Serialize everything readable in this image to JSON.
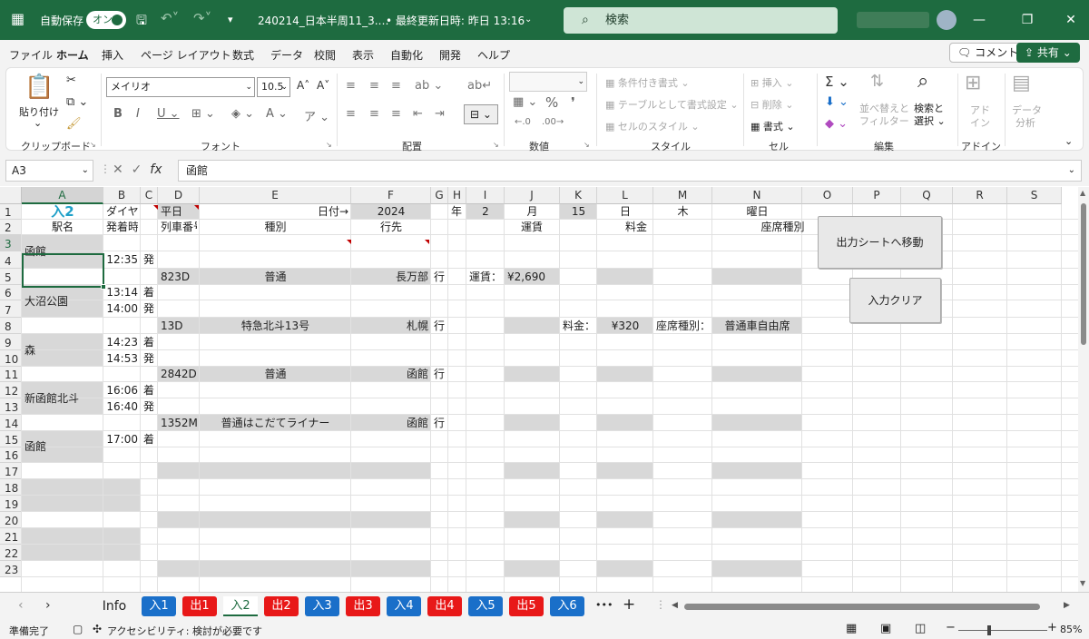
{
  "titlebar": {
    "autosave_label": "自動保存",
    "autosave_state": "オン",
    "filename": "240214_日本半周11_3.…",
    "last_modified": "• 最終更新日時: 昨日 13:16",
    "search_placeholder": "検索"
  },
  "menu": {
    "items": [
      "ファイル",
      "ホーム",
      "挿入",
      "ページ レイアウト",
      "数式",
      "データ",
      "校閲",
      "表示",
      "自動化",
      "開発",
      "ヘルプ"
    ],
    "comment_label": "コメント",
    "share_label": "共有"
  },
  "ribbon": {
    "clipboard": {
      "paste": "貼り付け",
      "group": "クリップボード"
    },
    "font": {
      "name": "メイリオ",
      "size": "10.5",
      "group": "フォント"
    },
    "alignment": {
      "group": "配置"
    },
    "number": {
      "group": "数値"
    },
    "styles": {
      "conditional": "条件付き書式",
      "table": "テーブルとして書式設定",
      "cell_style": "セルのスタイル",
      "group": "スタイル"
    },
    "cells": {
      "insert": "挿入",
      "delete": "削除",
      "format": "書式",
      "group": "セル"
    },
    "editing": {
      "sort": "並べ替えと",
      "filter": "フィルター",
      "find": "検索と",
      "select": "選択",
      "group": "編集"
    },
    "addin": {
      "label1": "アド",
      "label2": "イン",
      "group": "アドイン"
    },
    "analysis": {
      "label1": "データ",
      "label2": "分析"
    }
  },
  "formula_bar": {
    "namebox": "A3",
    "value": "函館"
  },
  "columns": [
    "A",
    "B",
    "C",
    "D",
    "E",
    "F",
    "G",
    "H",
    "I",
    "J",
    "K",
    "L",
    "M",
    "N",
    "O",
    "P",
    "Q",
    "R",
    "S"
  ],
  "rows": [
    "1",
    "2",
    "3",
    "4",
    "5",
    "6",
    "7",
    "8",
    "9",
    "10",
    "11",
    "12",
    "13",
    "14",
    "15",
    "16",
    "17",
    "18",
    "19",
    "20",
    "21",
    "22",
    "23"
  ],
  "cells": {
    "a1": "入2",
    "b1": "ダイヤ：",
    "d1": "平日",
    "e1": "日付→",
    "f1": "2024",
    "h1": "年",
    "i1": "2",
    "j1": "月",
    "k1": "15",
    "l1": "日",
    "m1": "木",
    "n1": "曜日",
    "a2": "駅名",
    "b2": "発着時刻",
    "d2": "列車番号",
    "e2": "種別",
    "f2": "行先",
    "j2": "運賃",
    "l2": "料金",
    "n2": "座席種別",
    "a3": "函館",
    "b4": "12:35",
    "c4": "発",
    "d5": "823D",
    "e5": "普通",
    "f5": "長万部",
    "g5": "行",
    "i5": "運賃：",
    "j5": "¥2,690",
    "a6": "大沼公園",
    "b6": "13:14",
    "c6": "着",
    "b7": "14:00",
    "c7": "発",
    "d8": "13D",
    "e8": "特急北斗13号",
    "f8": "札幌",
    "g8": "行",
    "k8": "料金：",
    "l8": "¥320",
    "m8": "座席種別：",
    "n8": "普通車自由席",
    "a9": "森",
    "b9": "14:23",
    "c9": "着",
    "b10": "14:53",
    "c10": "発",
    "d11": "2842D",
    "e11": "普通",
    "f11": "函館",
    "g11": "行",
    "a12": "新函館北斗",
    "b12": "16:06",
    "c12": "着",
    "b13": "16:40",
    "c13": "発",
    "d14": "1352M",
    "e14": "普通はこだてライナー",
    "f14": "函館",
    "g14": "行",
    "a15": "函館",
    "b15": "17:00",
    "c15": "着"
  },
  "buttons": {
    "move_output": "出力シートへ移動",
    "clear_input": "入力クリア"
  },
  "sheet_tabs": {
    "info": "Info",
    "in1": "入1",
    "out1": "出1",
    "in2": "入2",
    "out2": "出2",
    "in3": "入3",
    "out3": "出3",
    "in4": "入4",
    "out4": "出4",
    "in5": "入5",
    "out5": "出5",
    "in6": "入6",
    "more": "•••",
    "add": "+"
  },
  "status": {
    "ready": "準備完了",
    "accessibility": "アクセシビリティ: 検討が必要です",
    "zoom": "85%"
  },
  "colors": {
    "excel_green": "#1e6b40",
    "tab_blue": "#1a6fc9",
    "tab_red": "#e81818",
    "cell_gray": "#d8d8d8",
    "title_cyan": "#1fa0c8"
  }
}
